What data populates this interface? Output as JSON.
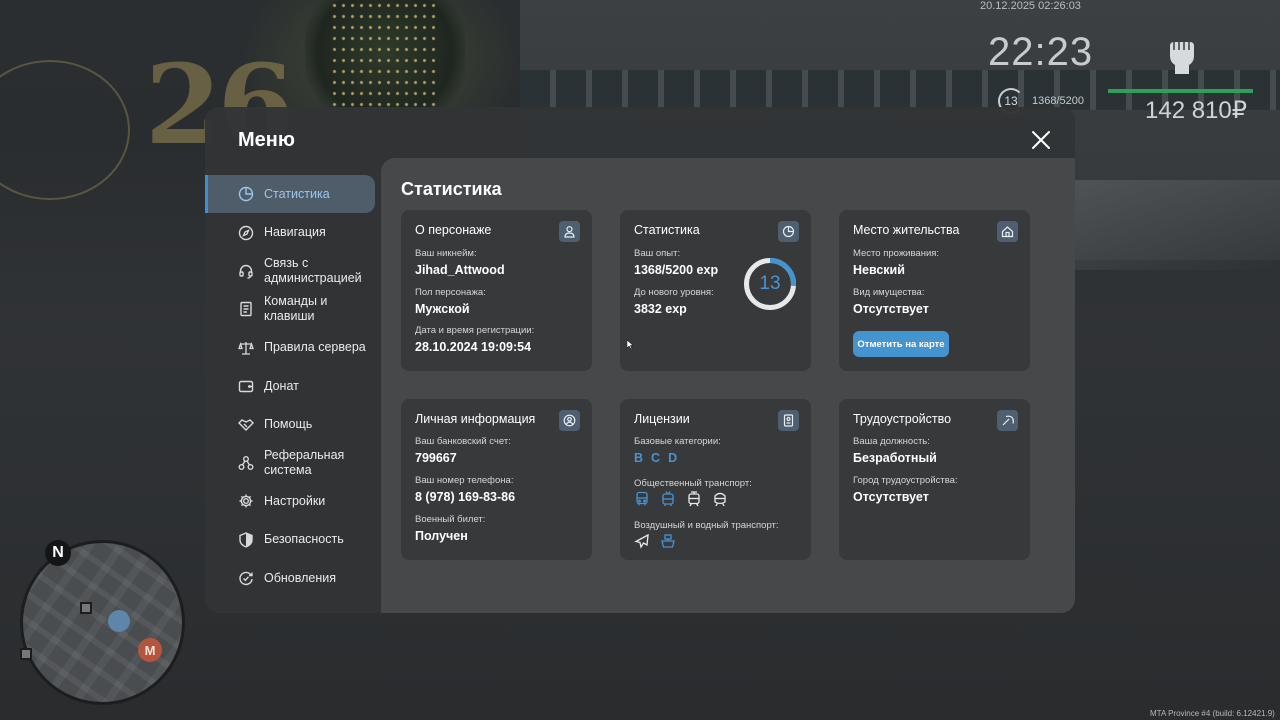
{
  "hud": {
    "datetime": "20.12.2025 02:26:03",
    "clock": "22:23",
    "money": "142 810₽",
    "level": "13",
    "exp": "1368/5200",
    "version": "MTA Province #4 (build: 6.12421.9)",
    "minimap_north": "N",
    "minimap_metro": "М",
    "bg_deco": "26"
  },
  "menu": {
    "title": "Меню",
    "sidebar": [
      {
        "label": "Статистика",
        "icon": "pie-chart-icon",
        "active": true
      },
      {
        "label": "Навигация",
        "icon": "compass-icon"
      },
      {
        "label": "Связь с администрацией",
        "icon": "headset-icon"
      },
      {
        "label": "Команды и клавиши",
        "icon": "document-icon"
      },
      {
        "label": "Правила сервера",
        "icon": "scales-icon"
      },
      {
        "label": "Донат",
        "icon": "wallet-icon"
      },
      {
        "label": "Помощь",
        "icon": "handshake-icon"
      },
      {
        "label": "Реферальная система",
        "icon": "network-icon"
      },
      {
        "label": "Настройки",
        "icon": "gear-icon"
      },
      {
        "label": "Безопасность",
        "icon": "shield-icon"
      },
      {
        "label": "Обновления",
        "icon": "refresh-check-icon"
      }
    ]
  },
  "content": {
    "title": "Статистика",
    "character": {
      "title": "О персонаже",
      "nickname_label": "Ваш никнейм:",
      "nickname": "Jihad_Attwood",
      "gender_label": "Пол персонажа:",
      "gender": "Мужской",
      "reg_label": "Дата и время регистрации:",
      "reg": "28.10.2024 19:09:54"
    },
    "stats": {
      "title": "Статистика",
      "exp_label": "Ваш опыт:",
      "exp": "1368/5200 exp",
      "next_label": "До нового уровня:",
      "next": "3832 exp",
      "level": "13",
      "progress": 0.263
    },
    "residence": {
      "title": "Место жительства",
      "place_label": "Место проживания:",
      "place": "Невский",
      "property_label": "Вид имущества:",
      "property": "Отсутствует",
      "button": "Отметить на карте"
    },
    "personal": {
      "title": "Личная информация",
      "bank_label": "Ваш банковский счет:",
      "bank": "799667",
      "phone_label": "Ваш номер телефона:",
      "phone": "8 (978) 169-83-86",
      "military_label": "Военный билет:",
      "military": "Получен"
    },
    "licenses": {
      "title": "Лицензии",
      "base_label": "Базовые категории:",
      "categories": [
        "B",
        "C",
        "D"
      ],
      "public_label": "Общественный транспорт:",
      "public_icons": [
        "bus-icon",
        "trolleybus-icon",
        "tram-icon",
        "metro-icon"
      ],
      "air_label": "Воздушный и водный транспорт:",
      "air_icons": [
        "plane-icon",
        "ship-icon"
      ]
    },
    "employment": {
      "title": "Трудоустройство",
      "position_label": "Ваша должность:",
      "position": "Безработный",
      "city_label": "Город трудоустройства:",
      "city": "Отсутствует"
    }
  },
  "colors": {
    "accent": "#4394cf",
    "hud_health": "#2fa05a",
    "metro": "#b5553e"
  }
}
